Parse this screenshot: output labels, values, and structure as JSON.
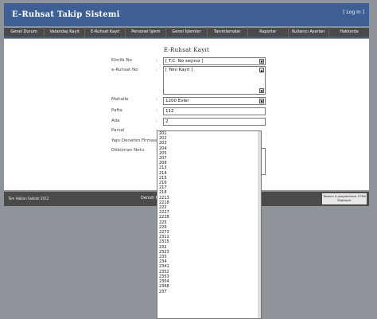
{
  "app": {
    "title": "E-Ruhsat Takip Sistemi",
    "login": "[ Log In ]"
  },
  "nav": [
    "Genel Durum",
    "Vatandaş Kayıt",
    "E-Ruhsat Kayıt",
    "Personel İşlem",
    "Genel İşlemler",
    "Tanımlamalar",
    "Raporlar",
    "Kullanıcı Ayarları",
    "Hakkında"
  ],
  "form": {
    "title": "E-Ruhsat Kayıt",
    "kimlik_label": "Kimlik No",
    "kimlik_value": "[ T.C. No seçiniz ]",
    "eruhsat_label": "e-Ruhsat No",
    "eruhsat_value": "[ Yeni Kayıt ]",
    "mahalle_label": "Mahalle",
    "mahalle_value": "1200 Evler",
    "pafta_label": "Pafta",
    "pafta_value": "112",
    "ada_label": "Ada",
    "ada_value": "2",
    "parsel_label": "Parsel",
    "yapi_label": "Yapı Denetim Firması",
    "dokuman_label": "Döküman Notu"
  },
  "parsel_options": [
    "201",
    "202",
    "203",
    "204",
    "205",
    "207",
    "208",
    "213",
    "214",
    "215",
    "216",
    "217",
    "218",
    "2213",
    "2218",
    "222",
    "2227",
    "2228",
    "225",
    "226",
    "2273",
    "2311",
    "2315",
    "232",
    "2323",
    "233",
    "234",
    "2341",
    "2352",
    "2353",
    "2354",
    "2368",
    "237"
  ],
  "footer": {
    "copyright": "Tüm Hakları Saklıdır 2012",
    "center": "Denizli B",
    "credit": "Tasarım & programlama ©YNS Bilgisayar"
  }
}
